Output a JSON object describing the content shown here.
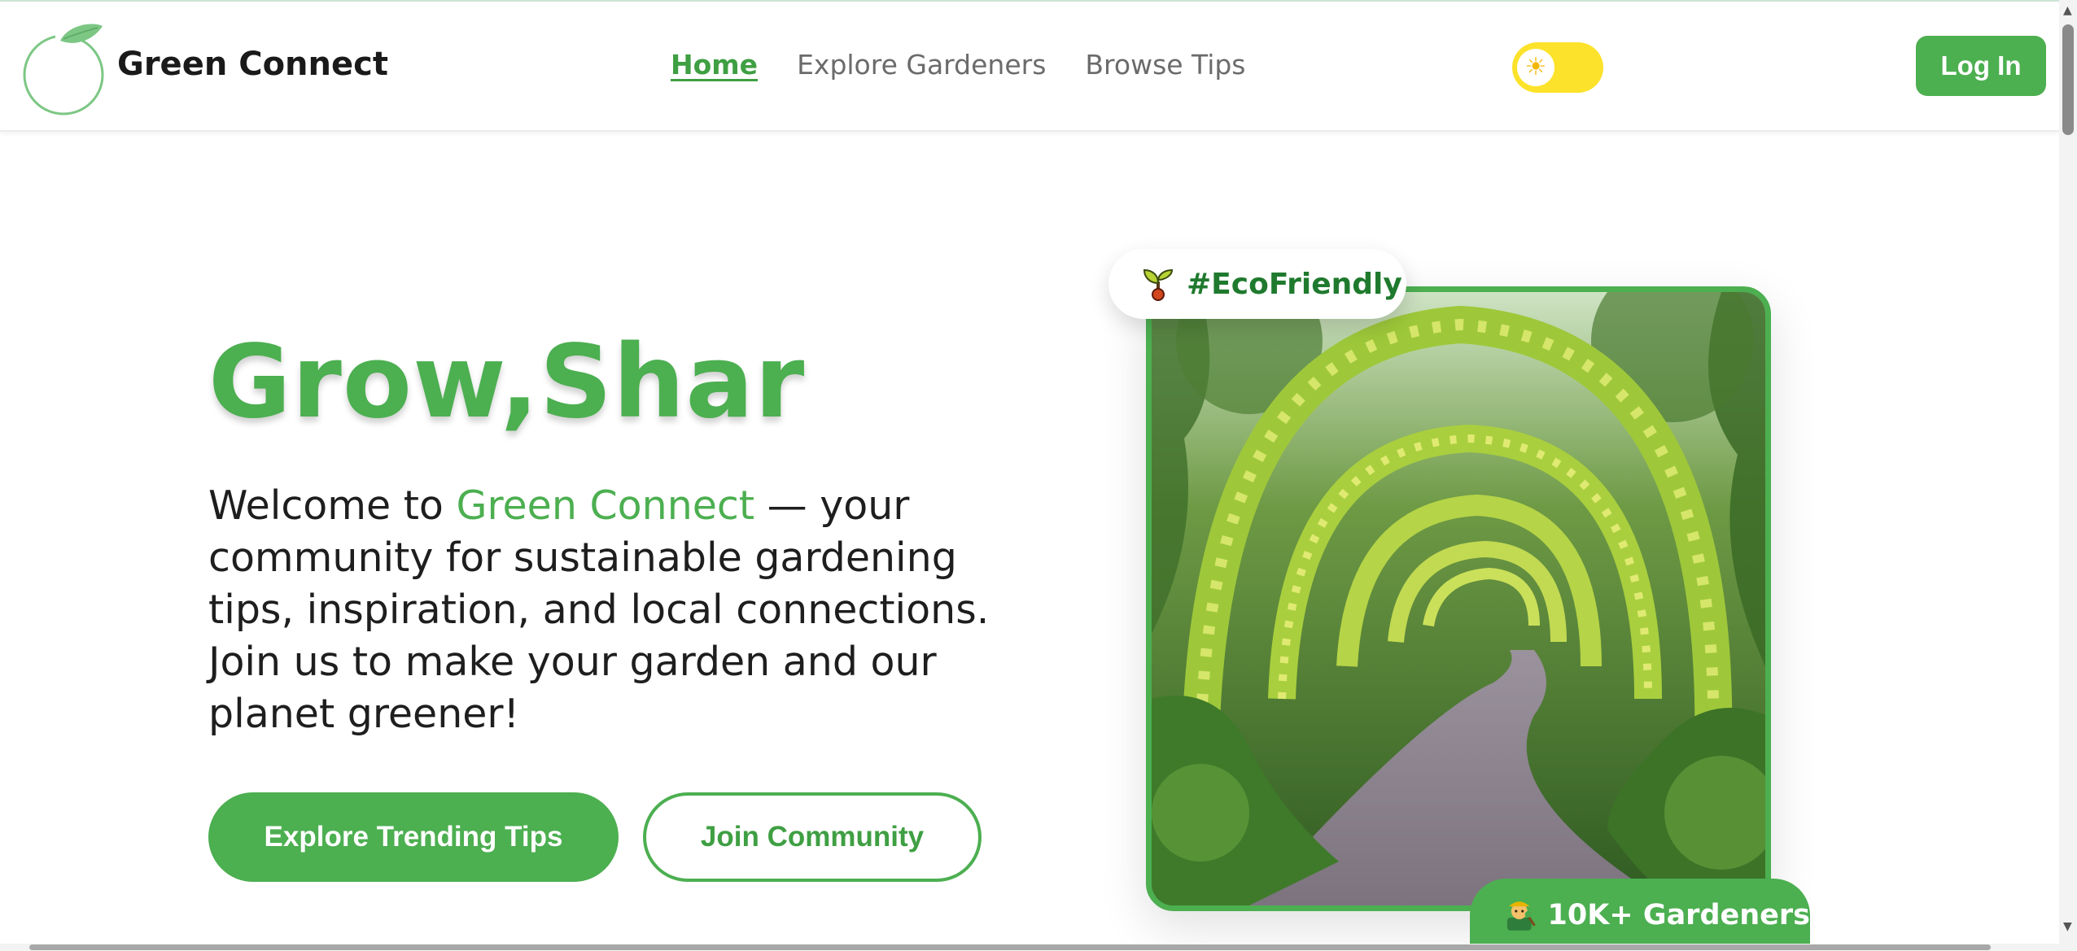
{
  "brand": {
    "name": "Green Connect",
    "logo_icon": "leaf-circle-icon"
  },
  "nav": {
    "links": [
      {
        "label": "Home",
        "active": true
      },
      {
        "label": "Explore Gardeners",
        "active": false
      },
      {
        "label": "Browse Tips",
        "active": false
      }
    ]
  },
  "theme_toggle": {
    "icon": "sun-icon",
    "state": "light"
  },
  "auth": {
    "login_label": "Log In"
  },
  "hero": {
    "title": "Grow,Shar",
    "intro_prefix": "Welcome to ",
    "intro_highlight": "Green Connect",
    "intro_suffix": " — your community for sustainable gardening tips, inspiration, and local connections. Join us to make your garden and our planet greener!",
    "primary_cta": "Explore Trending Tips",
    "secondary_cta": "Join Community"
  },
  "feature_card": {
    "tag_label": "#EcoFriendly",
    "tag_icon": "seedling-icon",
    "stat_label": "10K+ Gardeners",
    "stat_icon": "farmer-icon"
  },
  "colors": {
    "accent": "#4caf50",
    "accent_dark": "#1f7a2e",
    "toggle": "#fce22a",
    "text": "#1e1e1e",
    "nav_muted": "#6b6b6b"
  }
}
